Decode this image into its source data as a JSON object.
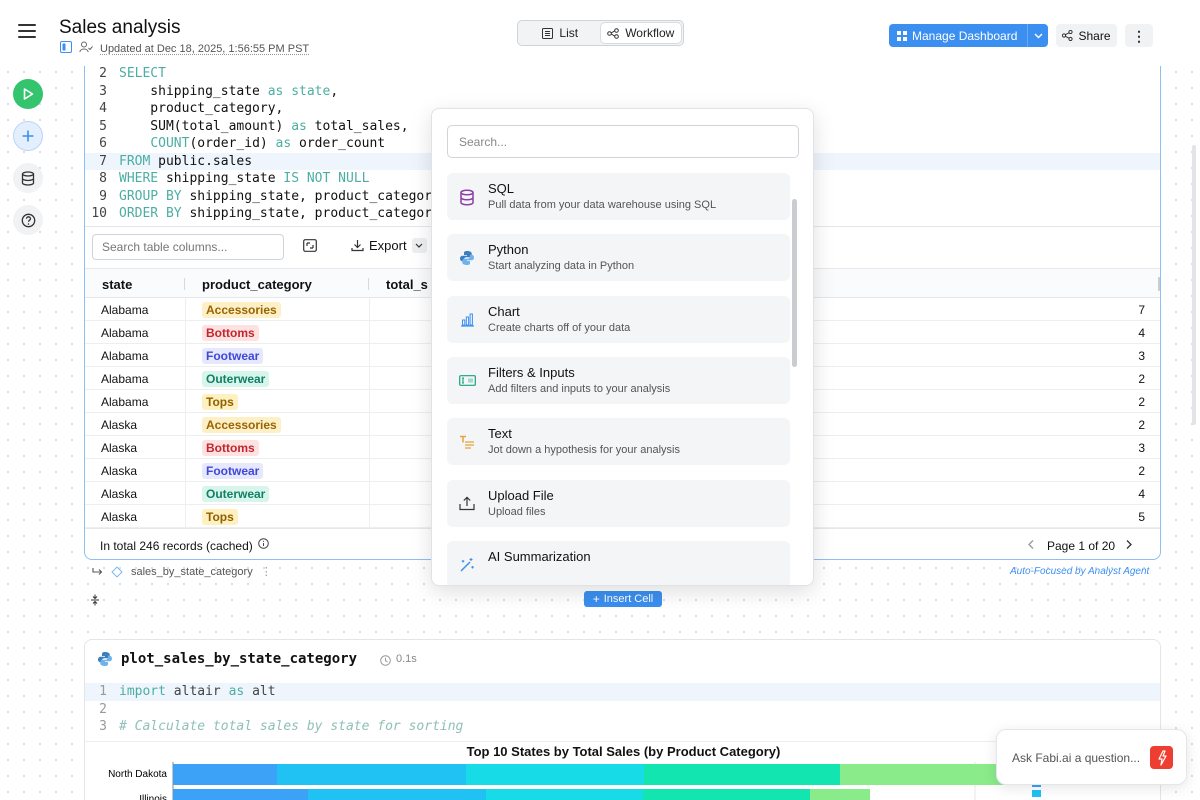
{
  "header": {
    "title": "Sales analysis",
    "updated": "Updated at Dec 18, 2025, 1:56:55 PM PST",
    "view_list": "List",
    "view_workflow": "Workflow",
    "manage_dashboard": "Manage Dashboard",
    "share": "Share"
  },
  "sql_cell": {
    "code_lines": [
      {
        "n": "2",
        "tokens": [
          [
            "SELECT",
            "kw"
          ]
        ]
      },
      {
        "n": "3",
        "tokens": [
          [
            "    shipping_state ",
            ""
          ],
          [
            "as",
            "kw"
          ],
          [
            " ",
            ""
          ],
          [
            "state",
            "kw"
          ],
          [
            ",",
            ""
          ]
        ]
      },
      {
        "n": "4",
        "tokens": [
          [
            "    product_category,",
            ""
          ]
        ]
      },
      {
        "n": "5",
        "tokens": [
          [
            "    SUM(total_amount) ",
            ""
          ],
          [
            "as",
            "kw"
          ],
          [
            " total_sales,",
            ""
          ]
        ]
      },
      {
        "n": "6",
        "tokens": [
          [
            "    ",
            ""
          ],
          [
            "COUNT",
            "kw"
          ],
          [
            "(order_id) ",
            ""
          ],
          [
            "as",
            "kw"
          ],
          [
            " order_count",
            ""
          ]
        ]
      },
      {
        "n": "7",
        "tokens": [
          [
            "FROM",
            "kw"
          ],
          [
            " public.sales",
            ""
          ]
        ]
      },
      {
        "n": "8",
        "tokens": [
          [
            "WHERE",
            "kw"
          ],
          [
            " shipping_state ",
            ""
          ],
          [
            "IS NOT NULL",
            "kw"
          ]
        ]
      },
      {
        "n": "9",
        "tokens": [
          [
            "GROUP BY",
            "kw"
          ],
          [
            " shipping_state, product_category",
            ""
          ]
        ]
      },
      {
        "n": "10",
        "tokens": [
          [
            "ORDER BY",
            "kw"
          ],
          [
            " shipping_state, product_category",
            ""
          ]
        ]
      }
    ],
    "search_placeholder": "Search table columns...",
    "export_label": "Export",
    "columns": [
      "state",
      "product_category",
      "total_s"
    ],
    "rows": [
      {
        "state": "Alabama",
        "category": "Accessories",
        "count": "7"
      },
      {
        "state": "Alabama",
        "category": "Bottoms",
        "count": "4"
      },
      {
        "state": "Alabama",
        "category": "Footwear",
        "count": "3"
      },
      {
        "state": "Alabama",
        "category": "Outerwear",
        "count": "2"
      },
      {
        "state": "Alabama",
        "category": "Tops",
        "count": "2"
      },
      {
        "state": "Alaska",
        "category": "Accessories",
        "count": "2"
      },
      {
        "state": "Alaska",
        "category": "Bottoms",
        "count": "3"
      },
      {
        "state": "Alaska",
        "category": "Footwear",
        "count": "2"
      },
      {
        "state": "Alaska",
        "category": "Outerwear",
        "count": "4"
      },
      {
        "state": "Alaska",
        "category": "Tops",
        "count": "5"
      }
    ],
    "category_colors": {
      "Accessories": {
        "bg": "#fdf0c7",
        "fg": "#9a6400"
      },
      "Bottoms": {
        "bg": "#fde2e1",
        "fg": "#c2262d"
      },
      "Footwear": {
        "bg": "#e6e8fd",
        "fg": "#4048d6"
      },
      "Outerwear": {
        "bg": "#d8f5ec",
        "fg": "#118066"
      },
      "Tops": {
        "bg": "#fff0bf",
        "fg": "#8f6000"
      }
    },
    "records_text": "In total 246 records (cached)",
    "page_text": "Page 1 of 20",
    "output_name": "sales_by_state_category",
    "agent_note": "Auto-Focused by Analyst Agent"
  },
  "insert_cell": "Insert Cell",
  "popup": {
    "search_placeholder": "Search...",
    "items": [
      {
        "title": "SQL",
        "desc": "Pull data from your data warehouse using SQL",
        "icon": "database-icon",
        "color": "#8a3fa8"
      },
      {
        "title": "Python",
        "desc": "Start analyzing data in Python",
        "icon": "python-icon",
        "color": "#3c7ebf"
      },
      {
        "title": "Chart",
        "desc": "Create charts off of your data",
        "icon": "bar-chart-icon",
        "color": "#3b8ff0"
      },
      {
        "title": "Filters & Inputs",
        "desc": "Add filters and inputs to your analysis",
        "icon": "filter-input-icon",
        "color": "#17a37a"
      },
      {
        "title": "Text",
        "desc": "Jot down a hypothesis for your analysis",
        "icon": "text-icon",
        "color": "#e8a33b"
      },
      {
        "title": "Upload File",
        "desc": "Upload files",
        "icon": "upload-icon",
        "color": "#333333"
      },
      {
        "title": "AI Summarization",
        "desc": "",
        "icon": "magic-wand-icon",
        "color": "#3b8ff0"
      }
    ]
  },
  "python_cell": {
    "name": "plot_sales_by_state_category",
    "runtime": "0.1s",
    "code_lines": [
      {
        "n": "1",
        "text": "import altair as alt"
      },
      {
        "n": "2",
        "text": ""
      },
      {
        "n": "3",
        "text": "# Calculate total sales by state for sorting"
      }
    ]
  },
  "chart_data": {
    "type": "bar",
    "title": "Top 10 States by Total Sales (by Product Category)",
    "categories": [
      "North Dakota",
      "Illinois"
    ],
    "orientation": "horizontal stacked",
    "colors": [
      "#3ba2f7",
      "#20c2f4",
      "#17dbe6",
      "#12e5b0",
      "#8aeb8a"
    ]
  },
  "ask": {
    "placeholder": "Ask Fabi.ai a question..."
  }
}
